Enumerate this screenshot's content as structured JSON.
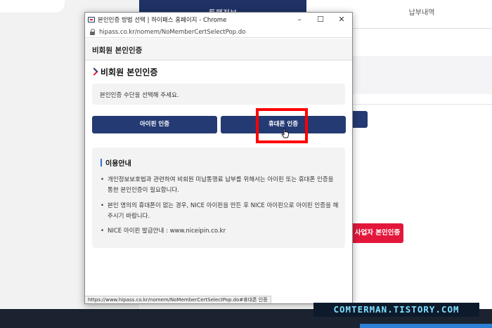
{
  "background": {
    "active_tab_label": "통행정보",
    "tab_2_label": "납부내역",
    "red_button_label": "사업자 본인인증",
    "watermark": "COMTERMAN.TISTORY.COM"
  },
  "window": {
    "title": "본인인증 방법 선택 | 하이패스 홈페이지 - Chrome",
    "minimize_glyph": "–",
    "maximize_glyph": "☐",
    "close_glyph": "✕",
    "url": "hipass.co.kr/nomem/NoMemberCertSelectPop.do"
  },
  "popup": {
    "header_title": "비회원 본인인증",
    "section_title": "비회원 본인인증",
    "select_prompt": "본인인증 수단을 선택해 주세요.",
    "ipin_button": "아이핀 인증",
    "phone_button": "휴대폰 인증",
    "info": {
      "title": "이용안내",
      "bullet": "•",
      "items": [
        "개인정보보호법과 관련하여 비회원 미납통행료 납부를 위해서는 아이핀 또는 휴대폰 인증을 통한 본인인증이 필요합니다.",
        "본인 명의의 휴대폰이 없는 경우, NICE 아이핀을 만든 후 NICE 아이핀으로 아이핀 인증을 해주시기 바랍니다.",
        "NICE 아이핀 발급안내 : www.niceipin.co.kr"
      ]
    },
    "status_url": "https://www.hipass.co.kr/nomem/NoMemberCertSelectPop.do#휴대폰 인증"
  },
  "colors": {
    "navy": "#243a73",
    "red_accent": "#e3173b",
    "highlight": "#ff0000",
    "info_bar": "#2c6fd8"
  },
  "icons": [
    "favicon-icon",
    "lock-icon",
    "chevron-right-icon",
    "hand-cursor-icon"
  ]
}
